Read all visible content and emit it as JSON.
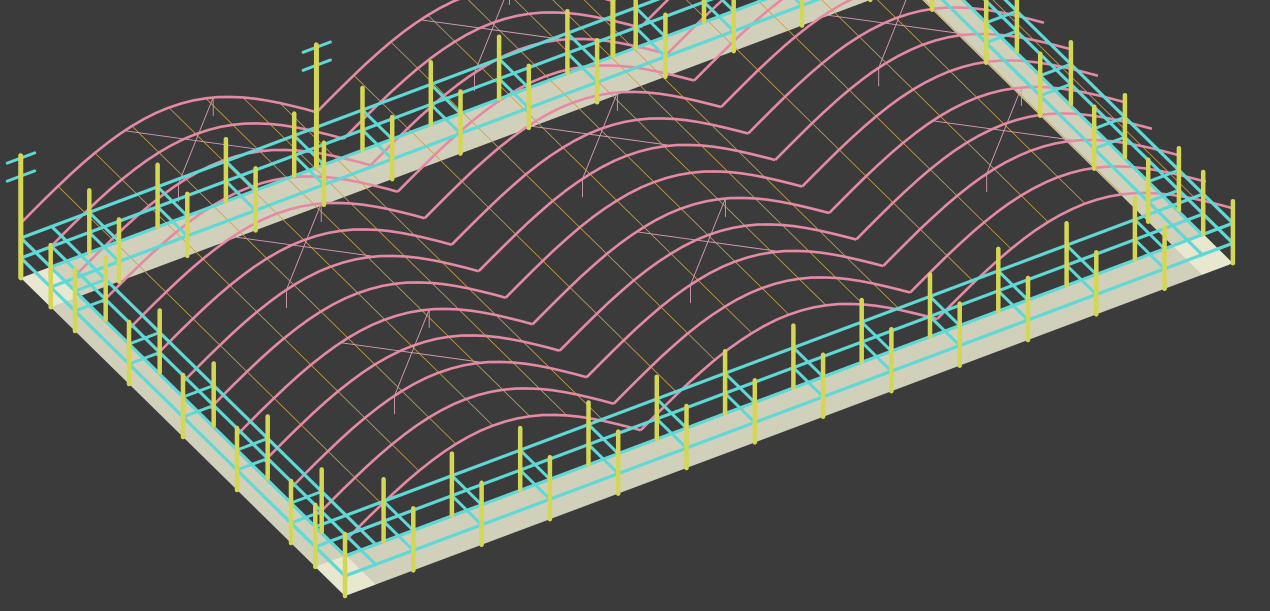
{
  "view": {
    "background_color": "#3b3b3b",
    "projection": "isometric"
  },
  "model": {
    "description_visible_text": "",
    "column_lines": 14,
    "arch_spans": 3,
    "colors": {
      "column": "#d4d656",
      "beam": "#5fd8d6",
      "arch": "#e48aa4",
      "bracing": "#d89ab8",
      "purlin": "#c9a24a",
      "slab": "#ecebd2"
    }
  }
}
